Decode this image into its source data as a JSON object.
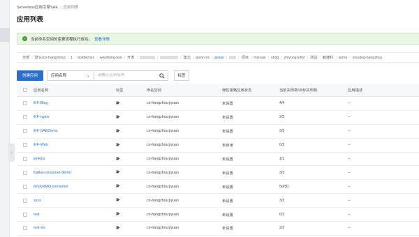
{
  "breadcrumb": {
    "root": "Serverless应用引擎SAE",
    "current": "应用列表"
  },
  "page_title": "应用列表",
  "notice": {
    "text": "当前命名空间的变更流程执行成功。",
    "link": "查看详情"
  },
  "namespaces": [
    {
      "label": "全部",
      "active": false
    },
    {
      "label": "默认(cn-hangzhou)",
      "active": false
    },
    {
      "label": "1",
      "active": false
    },
    {
      "label": "testdemo1",
      "active": false
    },
    {
      "label": "weizhong-test",
      "active": false
    },
    {
      "label": "开发",
      "active": false
    },
    {
      "label": "",
      "blurred": true
    },
    {
      "label": "",
      "blurred": true
    },
    {
      "label": "建北",
      "active": false
    },
    {
      "label": "jason-ns",
      "active": false
    },
    {
      "label": "jiyuan",
      "active": true
    },
    {
      "label": "",
      "blurred": true
    },
    {
      "label": "项目",
      "active": false
    },
    {
      "label": "md-sae",
      "active": false
    },
    {
      "label": "shdq",
      "active": false
    },
    {
      "label": "zhiyong ENV",
      "active": false
    },
    {
      "label": "测试",
      "active": false
    },
    {
      "label": "敏捷科",
      "active": false
    },
    {
      "label": "xumu",
      "active": false
    },
    {
      "label": "zouqing-hangzhou",
      "active": false
    }
  ],
  "toolbar": {
    "create_label": "创建应用",
    "filter_select": "应用名称",
    "search_placeholder": "请输入应用名称",
    "tag_button": "标签"
  },
  "table": {
    "headers": {
      "name": "应用名称",
      "tag": "标签",
      "namespace": "命名空间",
      "elastic": "弹性策略应用状态",
      "instances": "当前实例数/目标实例数",
      "desc": "应用描述"
    },
    "rows": [
      {
        "name": "iKF-Blog",
        "namespace": "cn-hangzhou:jiyuan",
        "elastic": "未设置",
        "instances": "4/4",
        "desc": "--"
      },
      {
        "name": "iKF-nginx",
        "namespace": "cn-hangzhou:jiyuan",
        "elastic": "未设置",
        "instances": "2/2",
        "desc": "--"
      },
      {
        "name": "iKF-SAEDemo",
        "namespace": "cn-hangzhou:jiyuan",
        "elastic": "未设置",
        "instances": "3/3",
        "desc": "--"
      },
      {
        "name": "iKF-Web",
        "namespace": "cn-hangzhou:jiyuan",
        "elastic": "未启用",
        "instances": "0/3",
        "desc": "--"
      },
      {
        "name": "jenkins",
        "namespace": "cn-hangzhou:jiyuan",
        "elastic": "未设置",
        "instances": "1/1",
        "desc": "--"
      },
      {
        "name": "Kafka-consumer-demo",
        "namespace": "cn-hangzhou:jiyuan",
        "elastic": "未设置",
        "instances": "3/3",
        "desc": "--"
      },
      {
        "name": "RocketMQ-consumer",
        "namespace": "cn-hangzhou:jiyuan",
        "elastic": "未设置",
        "instances": "50/50",
        "desc": "--"
      },
      {
        "name": "sszx",
        "namespace": "cn-hangzhou:jiyuan",
        "elastic": "未设置",
        "instances": "3/3",
        "desc": "--"
      },
      {
        "name": "test",
        "namespace": "cn-hangzhou:jiyuan",
        "elastic": "未设置",
        "instances": "0/2",
        "desc": "--"
      },
      {
        "name": "test-sls",
        "namespace": "cn-hangzhou:jiyuan",
        "elastic": "未设置",
        "instances": "2/2",
        "desc": "--"
      }
    ]
  },
  "colors": {
    "primary": "#2d6fc3",
    "success": "#3f9b2b",
    "notice_bg": "#eaf5e6"
  },
  "icons": {
    "notice": "check-circle-icon",
    "search": "search-icon",
    "select": "chevron-down-icon",
    "tag": "tag-icon",
    "collapse": "chevron-left-icon"
  }
}
